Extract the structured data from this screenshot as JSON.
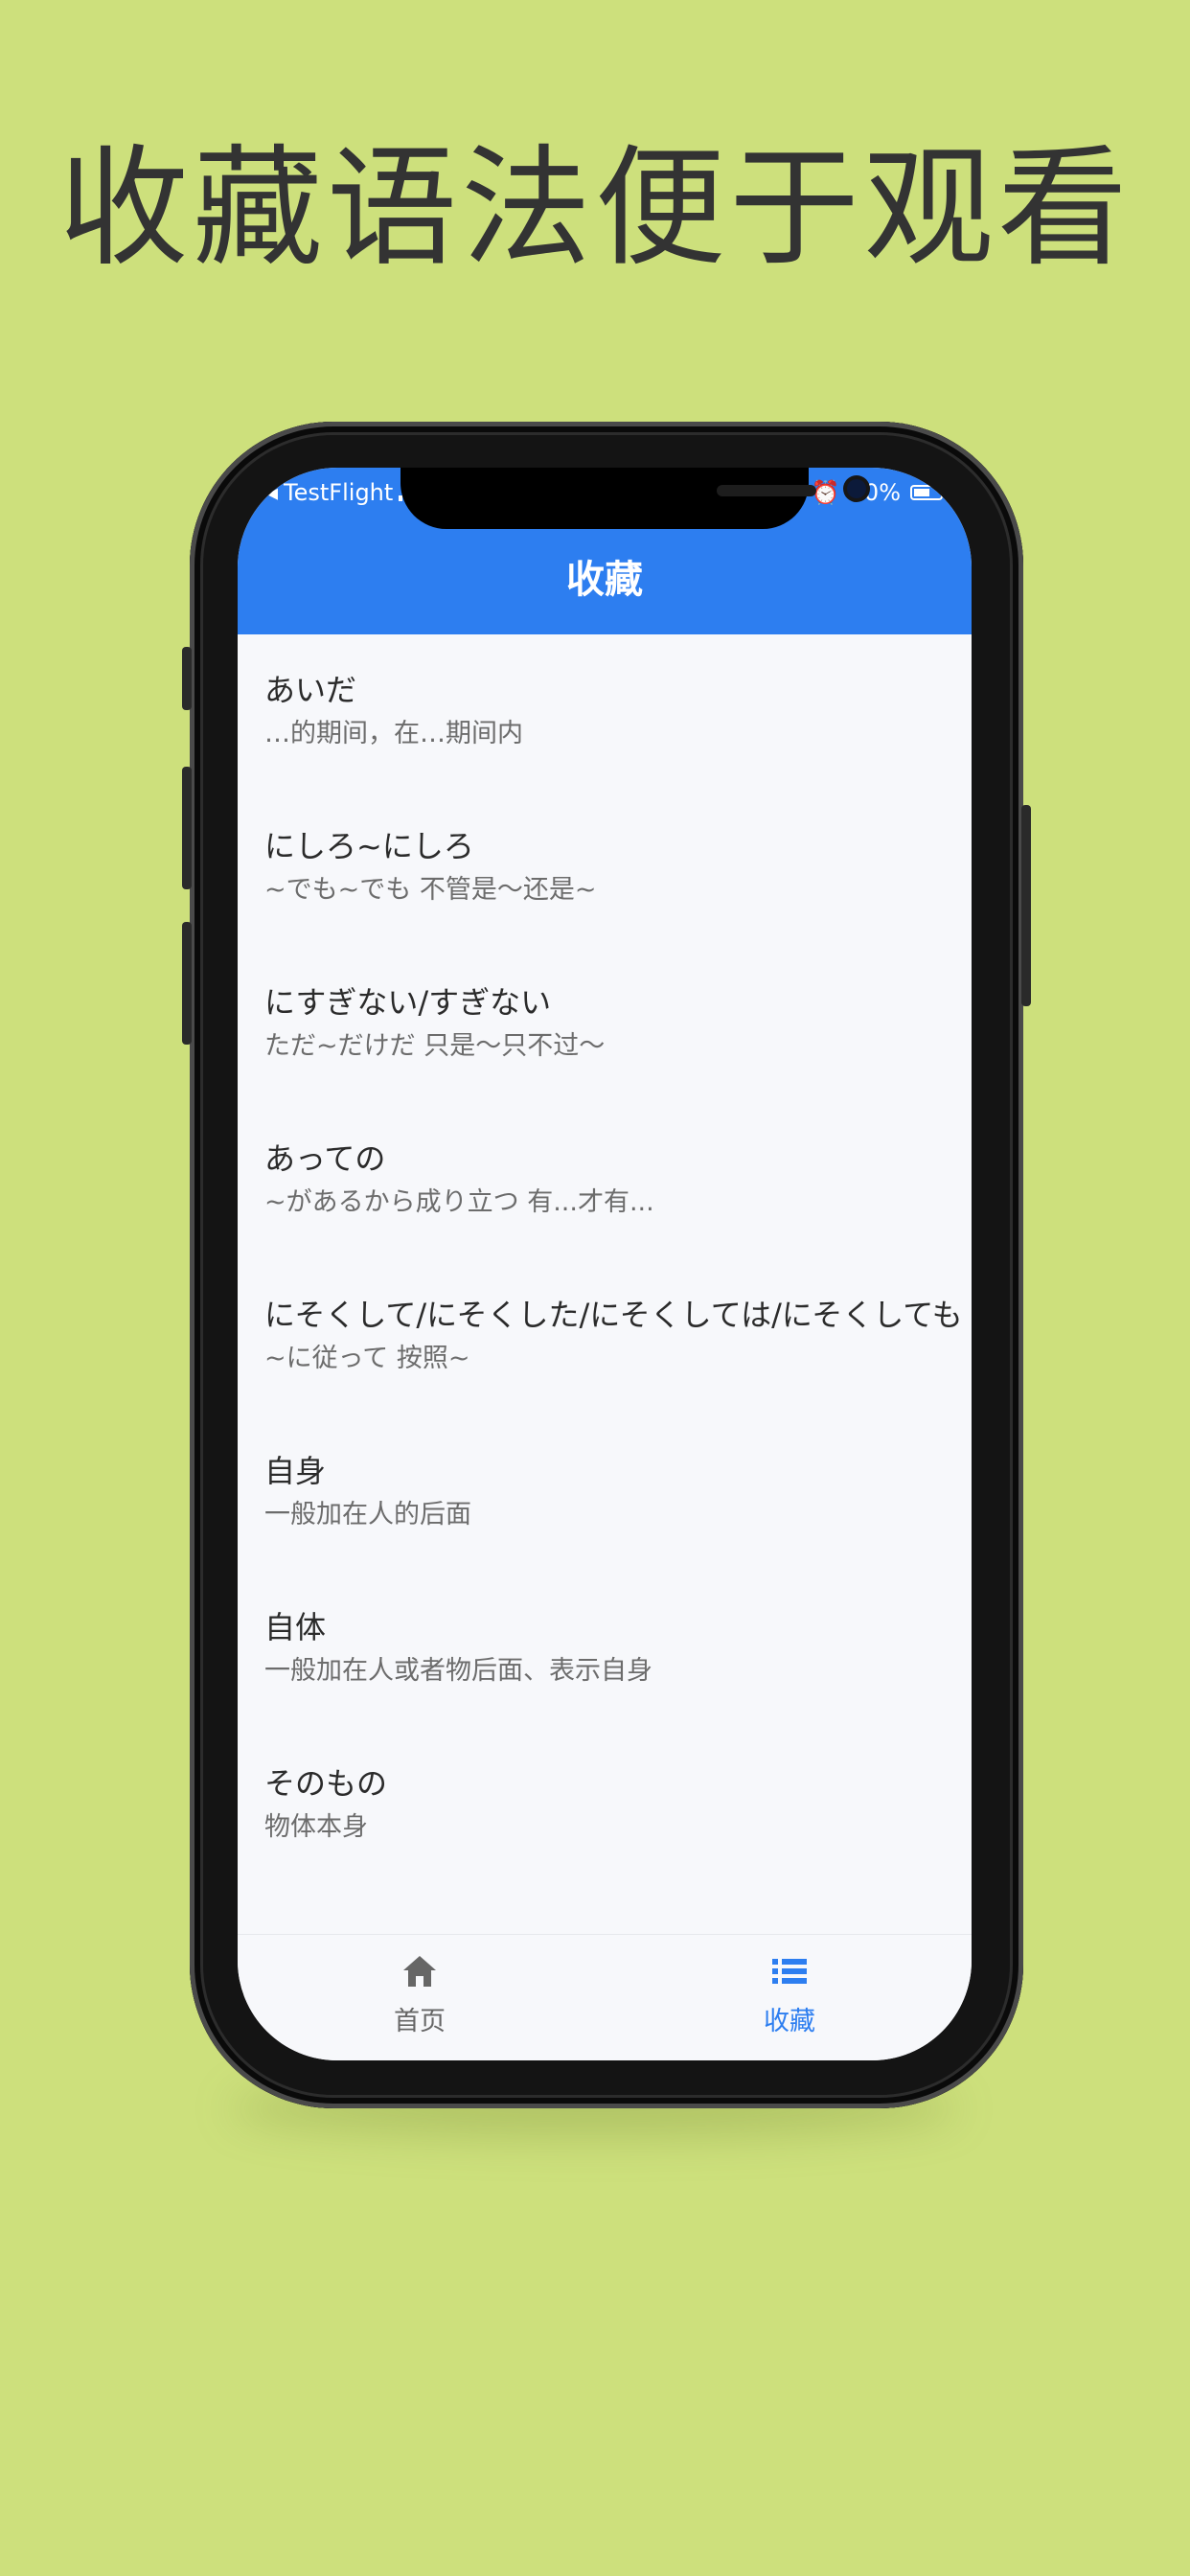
{
  "headline": "收藏语法便于观看",
  "status_bar": {
    "carrier": "TestFlight",
    "battery": "60%"
  },
  "header": {
    "title": "收藏"
  },
  "favorites": [
    {
      "term": "あいだ",
      "meaning": "…的期间，在…期间内"
    },
    {
      "term": "にしろ~にしろ",
      "meaning": "~でも~でも  不管是～还是~"
    },
    {
      "term": "にすぎない/すぎない",
      "meaning": "ただ~だけだ  只是～只不过～"
    },
    {
      "term": "あっての",
      "meaning": "~があるから成り立つ  有...才有..."
    },
    {
      "term": "にそくして/にそくした/にそくしては/にそくしても",
      "meaning": "~に従って  按照~"
    },
    {
      "term": "自身",
      "meaning": "一般加在人的后面"
    },
    {
      "term": "自体",
      "meaning": "一般加在人或者物后面、表示自身"
    },
    {
      "term": "そのもの",
      "meaning": "物体本身"
    }
  ],
  "tabbar": {
    "home": {
      "label": "首页",
      "icon": "home-icon"
    },
    "favorites": {
      "label": "收藏",
      "icon": "list-icon"
    },
    "active_color": "#2d7ef0",
    "inactive_color": "#666666"
  },
  "colors": {
    "background": "#cde07c",
    "header": "#2d7ef0"
  }
}
